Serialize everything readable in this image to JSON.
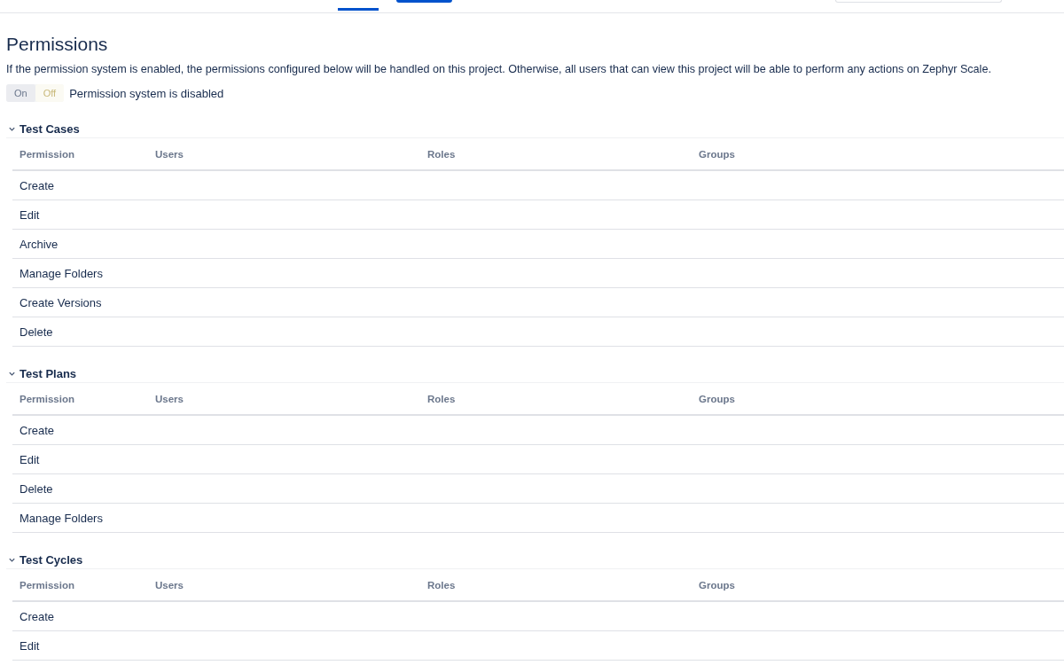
{
  "title": "Permissions",
  "description": "If the permission system is enabled, the permissions configured below will be handled on this project. Otherwise, all users that can view this project will be able to perform any actions on Zephyr Scale.",
  "toggle": {
    "on": false,
    "on_label": "On",
    "off_label": "Off",
    "status": "Permission system is disabled"
  },
  "sections": [
    {
      "title": "Test Cases",
      "expanded": true,
      "columns": [
        "Permission",
        "Users",
        "Roles",
        "Groups"
      ],
      "rows": [
        "Create",
        "Edit",
        "Archive",
        "Manage Folders",
        "Create Versions",
        "Delete"
      ]
    },
    {
      "title": "Test Plans",
      "expanded": true,
      "columns": [
        "Permission",
        "Users",
        "Roles",
        "Groups"
      ],
      "rows": [
        "Create",
        "Edit",
        "Delete",
        "Manage Folders"
      ]
    },
    {
      "title": "Test Cycles",
      "expanded": true,
      "columns": [
        "Permission",
        "Users",
        "Roles",
        "Groups"
      ],
      "rows": [
        "Create",
        "Edit"
      ]
    }
  ]
}
